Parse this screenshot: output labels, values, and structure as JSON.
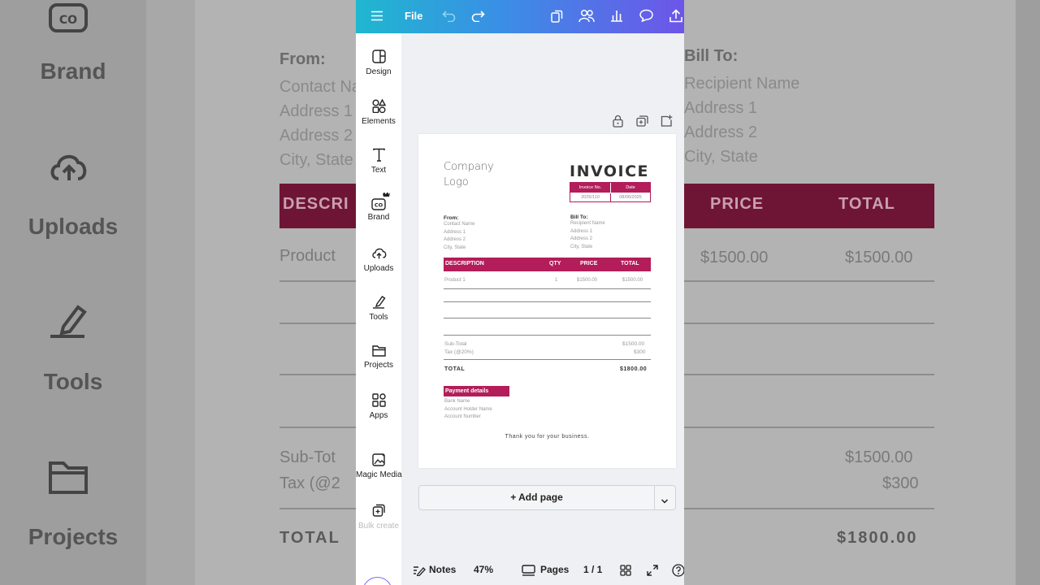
{
  "background": {
    "sidebar_labels": [
      "Brand",
      "Uploads",
      "Tools",
      "Projects"
    ],
    "from_heading": "From:",
    "from_lines": [
      "Contact Name",
      "Address 1",
      "Address 2",
      "City, State"
    ],
    "bill_heading": "Bill To:",
    "bill_lines": [
      "Recipient Name",
      "Address 1",
      "Address 2",
      "City, State"
    ],
    "table_headers": [
      "DESCRI",
      "PRICE",
      "TOTAL"
    ],
    "row_desc": "Product",
    "row_price": "$1500.00",
    "row_total": "$1500.00",
    "subtotal_label": "Sub-Tot",
    "subtotal_value": "$1500.00",
    "tax_label": "Tax (@2",
    "tax_value": "$300",
    "total_label": "TOTAL",
    "total_value": "$1800.00"
  },
  "topbar": {
    "file_label": "File"
  },
  "sidebar": {
    "items": [
      {
        "label": "Design",
        "icon": "design-icon"
      },
      {
        "label": "Elements",
        "icon": "elements-icon"
      },
      {
        "label": "Text",
        "icon": "text-icon"
      },
      {
        "label": "Brand",
        "icon": "brand-icon"
      },
      {
        "label": "Uploads",
        "icon": "uploads-icon"
      },
      {
        "label": "Tools",
        "icon": "tools-icon"
      },
      {
        "label": "Projects",
        "icon": "projects-icon"
      },
      {
        "label": "Apps",
        "icon": "apps-icon"
      },
      {
        "label": "Magic Media",
        "icon": "magic-media-icon"
      }
    ],
    "partial_label": "Bulk create"
  },
  "invoice": {
    "logo_line1": "Company",
    "logo_line2": "Logo",
    "title": "INVOICE",
    "invoice_no_label": "Invoice No.",
    "date_label": "Date",
    "invoice_no_value": "2025/110",
    "date_value": "08/06/2025",
    "from_heading": "From:",
    "from_lines": [
      "Contact Name",
      "Address 1",
      "Address 2",
      "City, State"
    ],
    "bill_heading": "Bill To:",
    "bill_lines": [
      "Recipient Name",
      "Address 1",
      "Address 2",
      "City, State"
    ],
    "columns": [
      "DESCRIPTION",
      "QTY",
      "PRICE",
      "TOTAL"
    ],
    "row": {
      "description": "Product 1",
      "qty": "1",
      "price": "$1500.00",
      "total": "$1500.00"
    },
    "subtotal_label": "Sub-Total",
    "subtotal_value": "$1500.00",
    "tax_label": "Tax (@20%)",
    "tax_value": "$300",
    "total_label": "TOTAL",
    "total_value": "$1800.00",
    "payment_heading": "Payment details",
    "payment_lines": [
      "Bank Name",
      "Account Holder Name",
      "Account Number"
    ],
    "thanks": "Thank you for your business.",
    "accent_color": "#b21d5a"
  },
  "add_page": {
    "label": "+ Add page"
  },
  "bottombar": {
    "notes_label": "Notes",
    "zoom": "47%",
    "pages_label": "Pages",
    "page_count": "1 / 1"
  },
  "colors": {
    "topbar_gradient_start": "#1fb7cf",
    "topbar_gradient_end": "#6d55e8",
    "canvas_bg": "#eef0f3"
  }
}
